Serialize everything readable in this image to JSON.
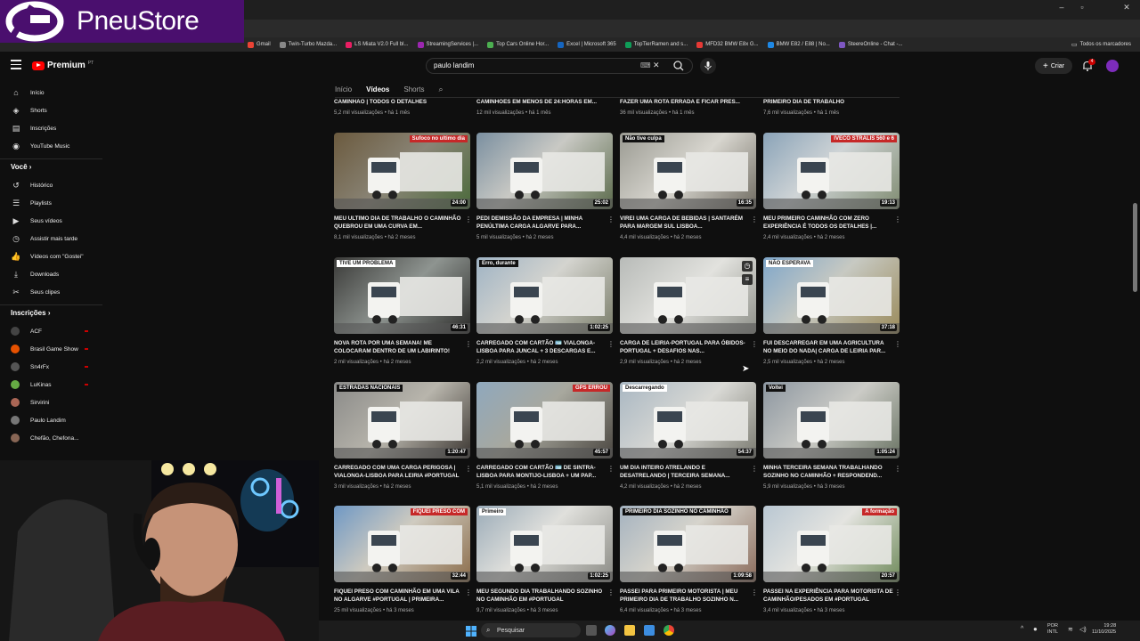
{
  "logo": {
    "text": "PneuStore"
  },
  "browser": {
    "bookmarks": [
      {
        "label": "Gmail",
        "color": "#ea4335"
      },
      {
        "label": "Twin-Turbo Mazda...",
        "color": "#888"
      },
      {
        "label": "LS Miata V2.0 Full bl...",
        "color": "#e91e63"
      },
      {
        "label": "StreamingServices |...",
        "color": "#9c27b0"
      },
      {
        "label": "Top Cars Online Hor...",
        "color": "#4caf50"
      },
      {
        "label": "Excel | Microsoft 365",
        "color": "#1565c0"
      },
      {
        "label": "TopTierRamen and s...",
        "color": "#0f9d58"
      },
      {
        "label": "MFD32 BMW E8x G...",
        "color": "#e53935"
      },
      {
        "label": "BMW E82 / E88 | No...",
        "color": "#1e88e5"
      },
      {
        "label": "SteereOnline - Chat -...",
        "color": "#7e57c2"
      }
    ],
    "all_bookmarks": "Todos os marcadores"
  },
  "youtube": {
    "brand": "Premium",
    "country": "PT",
    "search_query": "paulo landim",
    "create_label": "Criar",
    "notif_count": "4"
  },
  "sidebar": {
    "main": [
      {
        "label": "Início",
        "icon": "home-icon",
        "glyph": "⌂"
      },
      {
        "label": "Shorts",
        "icon": "shorts-icon",
        "glyph": "◈"
      },
      {
        "label": "Inscrições",
        "icon": "subscriptions-icon",
        "glyph": "▤"
      },
      {
        "label": "YouTube Music",
        "icon": "music-icon",
        "glyph": "◉"
      }
    ],
    "you_header": "Você",
    "you": [
      {
        "label": "Histórico",
        "icon": "history-icon",
        "glyph": "↺"
      },
      {
        "label": "Playlists",
        "icon": "playlists-icon",
        "glyph": "☰"
      },
      {
        "label": "Seus vídeos",
        "icon": "your-videos-icon",
        "glyph": "▶"
      },
      {
        "label": "Assistir mais tarde",
        "icon": "watch-later-icon",
        "glyph": "◷"
      },
      {
        "label": "Vídeos com \"Gostei\"",
        "icon": "liked-icon",
        "glyph": "👍"
      },
      {
        "label": "Downloads",
        "icon": "download-icon",
        "glyph": "⤓"
      },
      {
        "label": "Seus clipes",
        "icon": "clips-icon",
        "glyph": "✂"
      }
    ],
    "subs_header": "Inscrições",
    "subs": [
      {
        "label": "ACF",
        "color": "#444"
      },
      {
        "label": "Brasil Game Show",
        "color": "#e65100"
      },
      {
        "label": "Sn4rFx",
        "color": "#555"
      },
      {
        "label": "LuKinas",
        "color": "#6a4"
      },
      {
        "label": "Sirvirini",
        "color": "#a65"
      },
      {
        "label": "Paulo Landim",
        "color": "#777"
      },
      {
        "label": "Chefão, Chefona...",
        "color": "#865"
      }
    ]
  },
  "channel_tabs": [
    "Início",
    "Vídeos",
    "Shorts"
  ],
  "prev_row": [
    {
      "title": "CAMINHAO | TODOS O DETALHES",
      "meta": "5,2 mil visualizações • há 1 mês"
    },
    {
      "title": "CAMINHOES EM MENOS DE 24:HORAS EM...",
      "meta": "12 mil visualizações • há 1 mês"
    },
    {
      "title": "FAZER UMA ROTA ERRADA E FICAR PRES...",
      "meta": "36 mil visualizações • há 1 mês"
    },
    {
      "title": "PRIMEIRO DIA DE TRABALHO",
      "meta": "7,6 mil visualizações • há 1 mês"
    }
  ],
  "videos": [
    {
      "title": "MEU ULTIMO DIA DE TRABALHO O CAMINHÃO QUEBROU EM UMA CURVA EM...",
      "meta": "8,1 mil visualizações • há 2 meses",
      "duration": "24:00",
      "badge": "Sufoco no ultimo dia",
      "bg": "linear-gradient(135deg,#6b5a3e,#8a8577 50%,#4a6a3a)"
    },
    {
      "title": "PEDI DEMISSÃO DA EMPRESA | MINHA PENÚLTIMA CARGA ALGARVE PARA...",
      "meta": "5 mil visualizações • há 2 meses",
      "duration": "25:02",
      "badge": "",
      "bg": "linear-gradient(135deg,#7a8fa0,#c9c9c4 45%,#5a6a4a)"
    },
    {
      "title": "VIREI UMA CARGA DE BEBIDAS | SANTARÉM PARA MARGEM SUL LISBOA...",
      "meta": "4,4 mil visualizações • há 2 meses",
      "duration": "16:35",
      "badge": "Não tive culpa",
      "bg": "linear-gradient(135deg,#9a9a92,#d8d6cf 50%,#6e6a60)"
    },
    {
      "title": "MEU PRIMEIRO CAMINHÃO COM ZERO EXPERIÊNCIA É TODOS OS DETALHES |...",
      "meta": "2,4 mil visualizações • há 2 meses",
      "duration": "19:13",
      "badge": "IVECO STRALIS 560 e 6",
      "bg": "linear-gradient(135deg,#8aa3b8,#cfd4d6 45%,#7f8b70)"
    },
    {
      "title": "NOVA ROTA POR UMA SEMANA! ME COLOCARAM DENTRO DE UM LABIRINTO!",
      "meta": "2 mil visualizações • há 2 meses",
      "duration": "46:31",
      "badge": "TIVE UM PROBLEMA",
      "bg": "linear-gradient(135deg,#3a3a38,#8e9490 50%,#2a2a28)"
    },
    {
      "title": "CARREGADO COM CARTÃO 🪪 VIALONGA-LISBOA PARA JUNCAL + 3 DESCARGAS E...",
      "meta": "2,2 mil visualizações • há 2 meses",
      "duration": "1:02:25",
      "badge": "Erro, durante",
      "bg": "linear-gradient(135deg,#9fb3c4,#d4d4cf 45%,#7a7d6a)"
    },
    {
      "title": "CARGA DE LEIRIA-PORTUGAL PARA ÓBIDOS-PORTUGAL + DESAFIOS NAS...",
      "meta": "2,9 mil visualizações • há 2 meses",
      "duration": "",
      "badge": "",
      "bg": "linear-gradient(135deg,#b8bbb8,#e2e2de 50%,#8d8f88)"
    },
    {
      "title": "FUI DESCARREGAR EM UMA AGRICULTURA NO MEIO DO NADA| CARGA DE LEIRIA PAR...",
      "meta": "2,5 mil visualizações • há 2 meses",
      "duration": "37:18",
      "badge": "NÃO ESPERAVA",
      "bg": "linear-gradient(135deg,#7fa6c9,#c7c9c2 45%,#9a8a5a)"
    },
    {
      "title": "CARREGADO COM UMA CARGA PERIGOSA | VIALONGA-LISBOA PARA LEIRIA #portugal",
      "meta": "3 mil visualizações • há 2 meses",
      "duration": "1:20:47",
      "badge": "ESTRADAS NACIONAIS",
      "bg": "linear-gradient(135deg,#8a8a88,#b8b5ac 50%,#3a3530)"
    },
    {
      "title": "CARREGADO COM CARTÃO 🪪 DE SINTRA-LISBOA PARA MONTIJO-LISBOA + UM PAP...",
      "meta": "5,1 mil visualizações • há 2 meses",
      "duration": "45:57",
      "badge": "GPS ERROU",
      "bg": "linear-gradient(135deg,#8fa8bd,#a8a89e 45%,#4a4640)"
    },
    {
      "title": "UM DIA INTEIRO ATRELANDO E DESATRELANDO | TERCEIRA SEMANA...",
      "meta": "4,2 mil visualizações • há 2 meses",
      "duration": "54:37",
      "badge": "Descarregando",
      "bg": "linear-gradient(135deg,#a9b7c2,#d9d9d5 50%,#7a7a70)"
    },
    {
      "title": "MINHA TERCEIRA SEMANA TRABALHANDO SOZINHO NO CAMINHÃO + RESPONDEND...",
      "meta": "5,9 mil visualizações • há 3 meses",
      "duration": "1:05:24",
      "badge": "Voltei",
      "bg": "linear-gradient(135deg,#8c96a0,#cbcbc6 50%,#6a7464)"
    },
    {
      "title": "FIQUEI PRESO COM CAMINHÃO EM UMA VILA NO ALGARVE #portugal | PRIMEIRA...",
      "meta": "25 mil visualizações • há 3 meses",
      "duration": "32:44",
      "badge": "FIQUEI PRESO COM",
      "bg": "linear-gradient(135deg,#6f98c4,#cfcbc0 45%,#8b6c4a)"
    },
    {
      "title": "MEU SEGUNDO DIA TRABALHANDO SOZINHO NO CAMINHÃO EM #portugal",
      "meta": "9,7 mil visualizações • há 3 meses",
      "duration": "1:02:25",
      "badge": "Primeiro",
      "bg": "linear-gradient(135deg,#9aabb8,#e0e0dc 45%,#8a8a84)"
    },
    {
      "title": "PASSEI PARA PRIMEIRO MOTORISTA | MEU PRIMEIRO DIA DE TRABALHO SOZINHO N...",
      "meta": "6,4 mil visualizações • há 3 meses",
      "duration": "1:09:58",
      "badge": "PRIMEIRO DIA SOZINHO NO CAMINHÃO",
      "bg": "linear-gradient(135deg,#a4b2bf,#d6d4cc 45%,#8a6a5a)"
    },
    {
      "title": "PASSEI NA EXPERIÊNCIA PARA MOTORISTA DE CAMINHÃO/PESADOS EM #portugal",
      "meta": "3,4 mil visualizações • há 3 meses",
      "duration": "20:57",
      "badge": "A formação",
      "bg": "linear-gradient(135deg,#b9c7d2,#e4e4e0 45%,#6f8a5a)"
    }
  ],
  "taskbar": {
    "search_placeholder": "Pesquisar",
    "lang": "POR",
    "layout": "INTL",
    "time": "19:28",
    "date": "11/10/2025"
  }
}
